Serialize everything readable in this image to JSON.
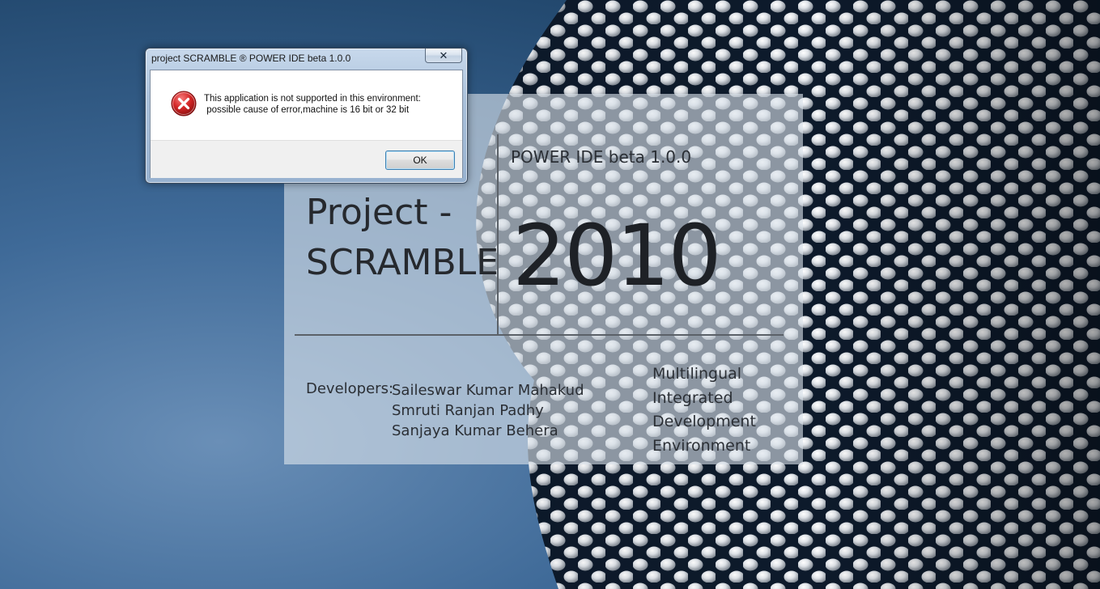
{
  "splash": {
    "title_line1": "Project -",
    "title_line2": "SCRAMBLE",
    "subtitle": "POWER IDE beta 1.0.0",
    "year": "2010",
    "developers_label": "Developers:",
    "developers": [
      "Saileswar Kumar Mahakud",
      "Smruti Ranjan Padhy",
      "Sanjaya Kumar Behera"
    ],
    "tagline": [
      "Multilingual",
      "Integrated",
      "Development",
      "Environment"
    ]
  },
  "dialog": {
    "title": "project SCRAMBLE ® POWER IDE beta 1.0.0",
    "close_label": "✕",
    "icon": "error-icon",
    "message_line1": "This application is not supported in this environment:",
    "message_line2": " possible cause of error,machine is 16 bit or 32 bit",
    "ok_label": "OK"
  },
  "colors": {
    "desktop_blue": "#3f6a98",
    "error_red": "#d32626",
    "button_focus": "#3c7fb1"
  }
}
